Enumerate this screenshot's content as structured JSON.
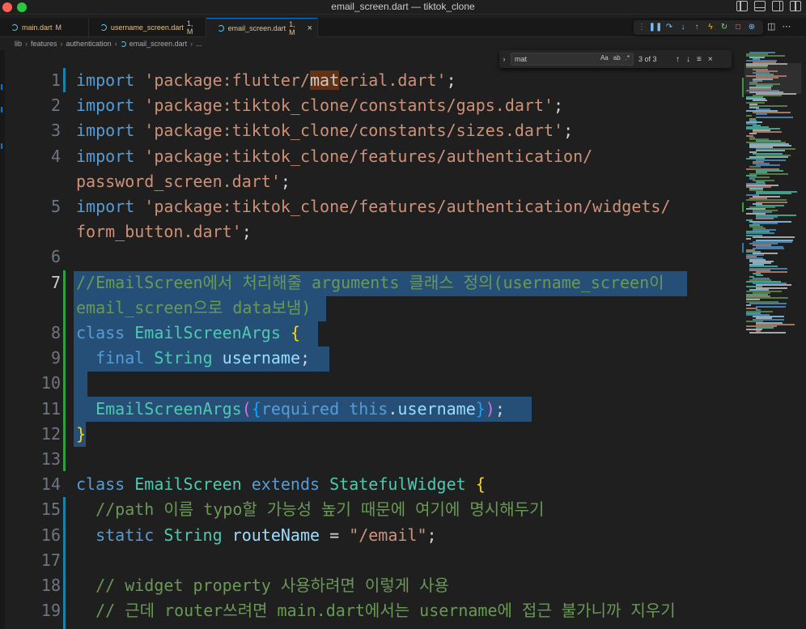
{
  "window": {
    "title": "email_screen.dart — tiktok_clone"
  },
  "tabs": [
    {
      "label": "main.dart",
      "status": "M"
    },
    {
      "label": "username_screen.dart",
      "status": "1, M"
    },
    {
      "label": "email_screen.dart",
      "status": "1, M"
    }
  ],
  "breadcrumb": [
    "lib",
    "features",
    "authentication",
    "email_screen.dart",
    "..."
  ],
  "find": {
    "query": "mat",
    "count": "3 of 3",
    "opt_case": "Aa",
    "opt_word": "ab",
    "opt_regex": ".*"
  },
  "icons": {
    "layout": [
      "toggle-primary-sidebar-icon",
      "toggle-panel-icon",
      "toggle-secondary-sidebar-icon",
      "customize-layout-icon"
    ],
    "debug": [
      "drag-handle-icon",
      "pause-icon",
      "step-over-icon",
      "step-into-icon",
      "step-out-icon",
      "hot-reload-icon",
      "restart-icon",
      "stop-icon",
      "open-devtools-icon"
    ]
  },
  "colors": {
    "keyword": "#569cd6",
    "string": "#ce9178",
    "class": "#4ec9b0",
    "comment": "#6a9955",
    "selection": "#264f78",
    "find_match": "#613214"
  },
  "code": {
    "lines": [
      {
        "n": "1",
        "parts": [
          [
            "kw",
            "import"
          ],
          [
            "pl",
            " "
          ],
          [
            "str",
            "'package:flutter/"
          ],
          [
            "match",
            "mat"
          ],
          [
            "str",
            "erial.dart'"
          ],
          [
            "pl",
            ";"
          ]
        ]
      },
      {
        "n": "2",
        "parts": [
          [
            "kw",
            "import"
          ],
          [
            "pl",
            " "
          ],
          [
            "str",
            "'package:tiktok_clone/constants/gaps.dart'"
          ],
          [
            "pl",
            ";"
          ]
        ]
      },
      {
        "n": "3",
        "parts": [
          [
            "kw",
            "import"
          ],
          [
            "pl",
            " "
          ],
          [
            "str",
            "'package:tiktok_clone/constants/sizes.dart'"
          ],
          [
            "pl",
            ";"
          ]
        ]
      },
      {
        "n": "4",
        "parts": [
          [
            "kw",
            "import"
          ],
          [
            "pl",
            " "
          ],
          [
            "str",
            "'package:tiktok_clone/features/authentication/"
          ]
        ]
      },
      {
        "n": "",
        "parts": [
          [
            "str",
            "password_screen.dart'"
          ],
          [
            "pl",
            ";"
          ]
        ]
      },
      {
        "n": "5",
        "parts": [
          [
            "kw",
            "import"
          ],
          [
            "pl",
            " "
          ],
          [
            "str",
            "'package:tiktok_clone/features/authentication/widgets/"
          ]
        ]
      },
      {
        "n": "",
        "parts": [
          [
            "str",
            "form_button.dart'"
          ],
          [
            "pl",
            ";"
          ]
        ]
      },
      {
        "n": "6",
        "parts": []
      },
      {
        "n": "7",
        "parts": [
          [
            "cm",
            "//EmailScreen에서 처리해줄 arguments 클래스 정의(username_screen이"
          ]
        ]
      },
      {
        "n": "",
        "parts": [
          [
            "cm",
            "email_screen으로 data보냄)"
          ]
        ]
      },
      {
        "n": "8",
        "parts": [
          [
            "kw",
            "class"
          ],
          [
            "pl",
            " "
          ],
          [
            "cls",
            "EmailScreenArgs"
          ],
          [
            "pl",
            " "
          ],
          [
            "br1",
            "{"
          ]
        ]
      },
      {
        "n": "9",
        "parts": [
          [
            "pl",
            "  "
          ],
          [
            "kw",
            "final"
          ],
          [
            "pl",
            " "
          ],
          [
            "cls",
            "String"
          ],
          [
            "pl",
            " "
          ],
          [
            "var",
            "username"
          ],
          [
            "pl",
            ";"
          ]
        ]
      },
      {
        "n": "10",
        "parts": []
      },
      {
        "n": "11",
        "parts": [
          [
            "pl",
            "  "
          ],
          [
            "cls",
            "EmailScreenArgs"
          ],
          [
            "br2",
            "("
          ],
          [
            "br3",
            "{"
          ],
          [
            "kw",
            "required"
          ],
          [
            "pl",
            " "
          ],
          [
            "kw",
            "this"
          ],
          [
            "pl",
            "."
          ],
          [
            "var",
            "username"
          ],
          [
            "br3",
            "}"
          ],
          [
            "br2",
            ")"
          ],
          [
            "pl",
            ";"
          ]
        ]
      },
      {
        "n": "12",
        "parts": [
          [
            "br1",
            "}"
          ]
        ]
      },
      {
        "n": "13",
        "parts": []
      },
      {
        "n": "14",
        "parts": [
          [
            "kw",
            "class"
          ],
          [
            "pl",
            " "
          ],
          [
            "cls",
            "EmailScreen"
          ],
          [
            "pl",
            " "
          ],
          [
            "kw",
            "extends"
          ],
          [
            "pl",
            " "
          ],
          [
            "cls",
            "StatefulWidget"
          ],
          [
            "pl",
            " "
          ],
          [
            "br1",
            "{"
          ]
        ]
      },
      {
        "n": "15",
        "parts": [
          [
            "pl",
            "  "
          ],
          [
            "cm",
            "//path 이름 typo할 가능성 높기 때문에 여기에 명시해두기"
          ]
        ]
      },
      {
        "n": "16",
        "parts": [
          [
            "pl",
            "  "
          ],
          [
            "kw",
            "static"
          ],
          [
            "pl",
            " "
          ],
          [
            "cls",
            "String"
          ],
          [
            "pl",
            " "
          ],
          [
            "var",
            "routeName"
          ],
          [
            "pl",
            " = "
          ],
          [
            "str",
            "\"/email\""
          ],
          [
            "pl",
            ";"
          ]
        ]
      },
      {
        "n": "17",
        "parts": []
      },
      {
        "n": "18",
        "parts": [
          [
            "pl",
            "  "
          ],
          [
            "cm",
            "// widget property 사용하려면 이렇게 사용"
          ]
        ]
      },
      {
        "n": "19",
        "parts": [
          [
            "pl",
            "  "
          ],
          [
            "cm",
            "// 근데 router쓰려면 main.dart에서는 username에 접근 불가니까 지우기"
          ]
        ]
      }
    ]
  }
}
